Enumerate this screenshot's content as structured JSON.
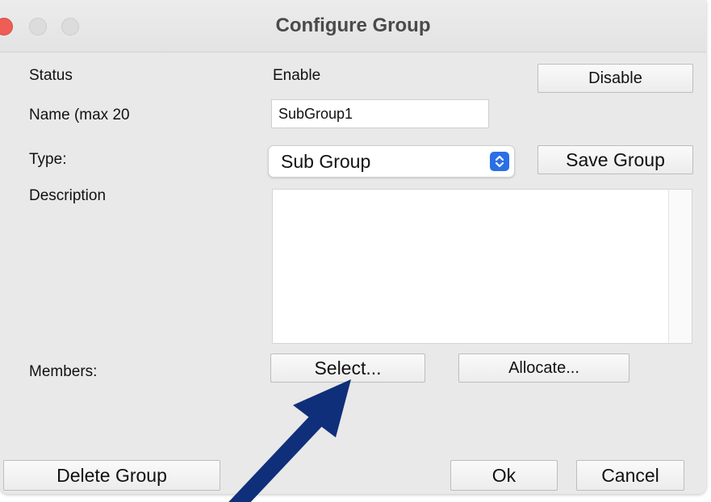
{
  "window": {
    "title": "Configure Group"
  },
  "status": {
    "label": "Status",
    "value": "Enable",
    "toggle_button": "Disable"
  },
  "name": {
    "label": "Name (max 20",
    "value": "SubGroup1"
  },
  "type": {
    "label": "Type:",
    "selected": "Sub Group",
    "save_button": "Save Group"
  },
  "description": {
    "label": "Description",
    "value": ""
  },
  "members": {
    "label": "Members:",
    "select_button": "Select...",
    "allocate_button": "Allocate..."
  },
  "footer": {
    "delete_button": "Delete Group",
    "ok_button": "Ok",
    "cancel_button": "Cancel"
  },
  "colors": {
    "accent": "#2a6fe6",
    "arrow": "#0f2f7a",
    "close": "#ee5d56"
  },
  "icons": {
    "dropdown": "chevron-updown-icon",
    "annotation": "arrow-icon"
  }
}
